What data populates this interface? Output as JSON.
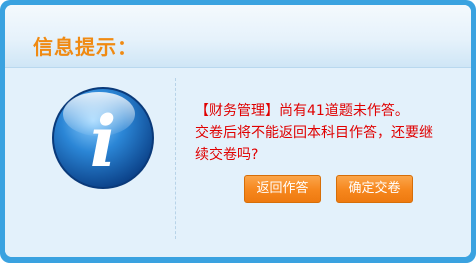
{
  "dialog": {
    "title": "信息提示："
  },
  "message": {
    "line1": "【财务管理】尚有41道题未作答。",
    "line2": "交卷后将不能返回本科目作答，还要继",
    "line3": "续交卷吗?"
  },
  "buttons": {
    "return_label": "返回作答",
    "submit_label": "确定交卷"
  },
  "icon": {
    "name": "info-icon",
    "glyph": "i"
  },
  "colors": {
    "frame": "#3aa2e0",
    "title": "#f08a12",
    "message": "#e00000",
    "button": "#f6861c"
  }
}
